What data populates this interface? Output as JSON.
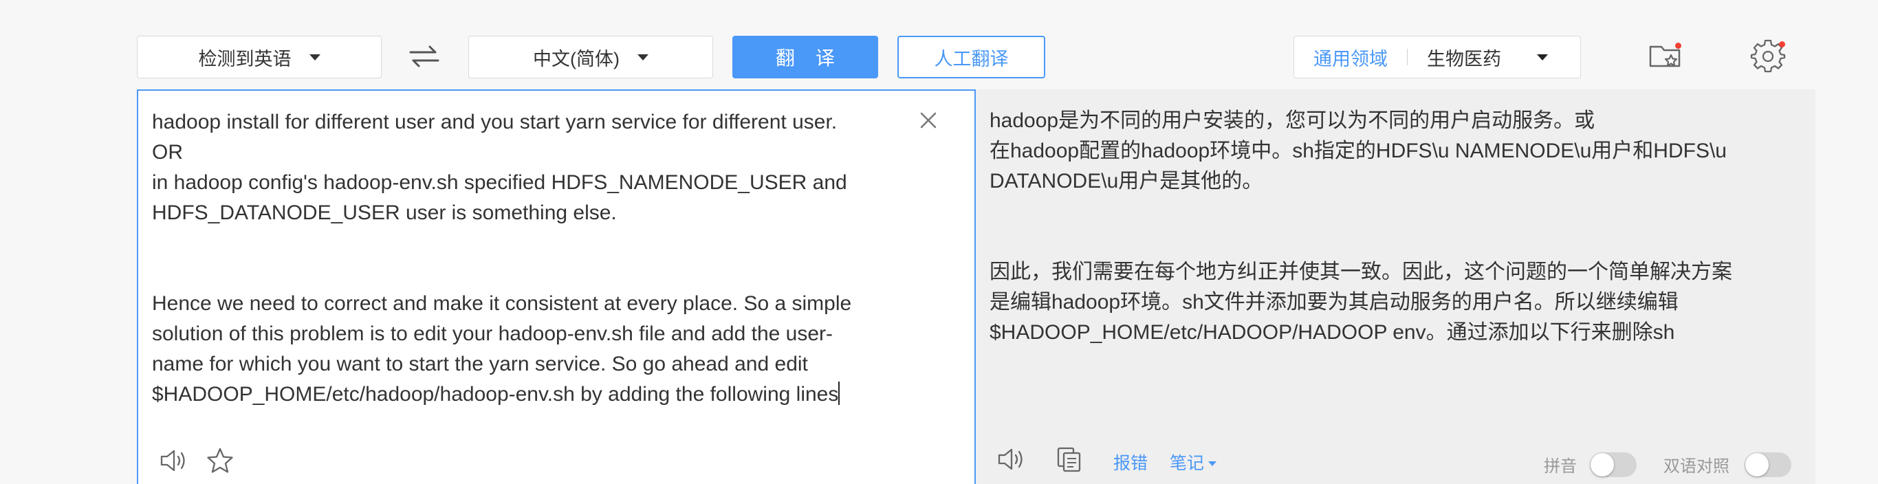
{
  "toolbar": {
    "source_lang": "检测到英语",
    "target_lang": "中文(简体)",
    "translate_label": "翻译",
    "human_translate_label": "人工翻译",
    "domain_general": "通用领域",
    "domain_selected": "生物医药"
  },
  "source": {
    "text": "hadoop install for different user and you start yarn service for different user.\nOR\nin hadoop config's hadoop-env.sh specified HDFS_NAMENODE_USER and\nHDFS_DATANODE_USER user is something else.\n\n\nHence we need to correct and make it consistent at every place. So a simple\nsolution of this problem is to edit your hadoop-env.sh file and add the user-\nname for which you want to start the yarn service. So go ahead and edit\n$HADOOP_HOME/etc/hadoop/hadoop-env.sh by adding the following lines"
  },
  "target": {
    "text": "hadoop是为不同的用户安装的，您可以为不同的用户启动服务。或\n在hadoop配置的hadoop环境中。sh指定的HDFS\\u NAMENODE\\u用户和HDFS\\u\nDATANODE\\u用户是其他的。\n\n\n因此，我们需要在每个地方纠正并使其一致。因此，这个问题的一个简单解决方案\n是编辑hadoop环境。sh文件并添加要为其启动服务的用户名。所以继续编辑\n$HADOOP_HOME/etc/HADOOP/HADOOP env。通过添加以下行来删除sh",
    "report_error": "报错",
    "notes": "笔记",
    "pinyin_label": "拼音",
    "bilingual_label": "双语对照"
  },
  "icons": {
    "swap": "swap-arrows-icon",
    "favorites": "star-folder-icon",
    "settings": "gear-icon",
    "clear": "close-icon",
    "speak": "speaker-icon",
    "star": "star-icon",
    "copy": "copy-icon"
  },
  "colors": {
    "accent": "#4a98f7",
    "notification": "#f04134",
    "target_bg": "#efefef"
  }
}
